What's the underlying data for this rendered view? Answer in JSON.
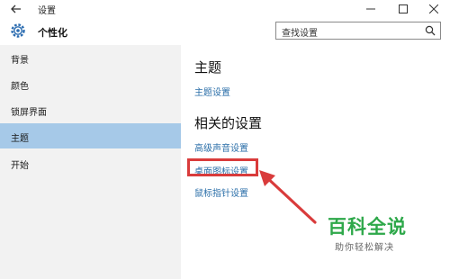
{
  "window": {
    "title": "设置",
    "controls": {
      "minimize": "minimize-icon",
      "maximize": "maximize-icon",
      "close": "close-icon"
    }
  },
  "header": {
    "section_title": "个性化",
    "search_placeholder": "查找设置"
  },
  "sidebar": {
    "items": [
      {
        "label": "背景"
      },
      {
        "label": "颜色"
      },
      {
        "label": "锁屏界面"
      },
      {
        "label": "主题",
        "selected": true
      },
      {
        "label": "开始"
      }
    ]
  },
  "main": {
    "theme_heading": "主题",
    "theme_settings_link": "主题设置",
    "related_heading": "相关的设置",
    "links": [
      {
        "label": "高级声音设置"
      },
      {
        "label": "桌面图标设置",
        "highlighted": true
      },
      {
        "label": "鼠标指针设置"
      }
    ]
  },
  "watermark": {
    "title": "百科全说",
    "subtitle": "助你轻松解决"
  },
  "colors": {
    "selected_item": "#a6c9e8",
    "link": "#2a6ea8",
    "highlight": "#d93b3b",
    "watermark": "#2ea84a"
  }
}
